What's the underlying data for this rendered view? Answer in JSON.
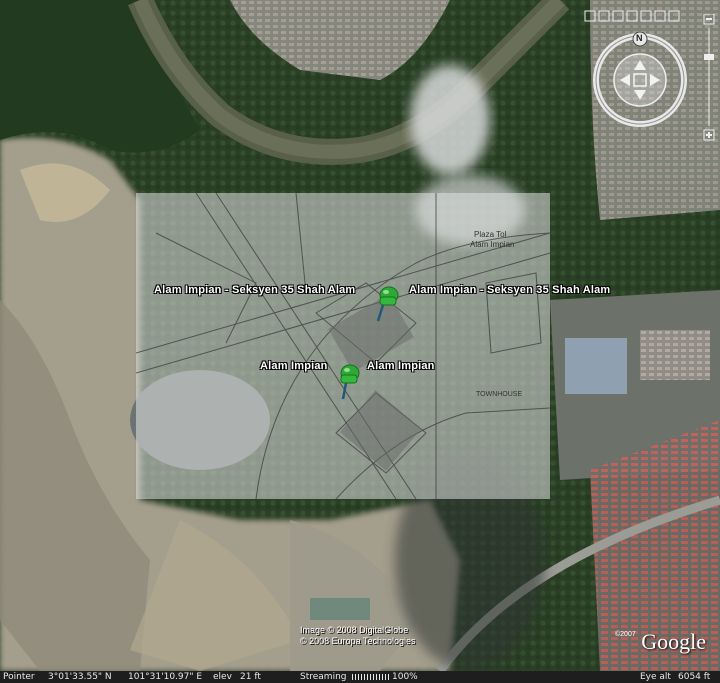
{
  "placemarks": [
    {
      "name": "Alam Impian - Seksyen 35 Shah Alam"
    },
    {
      "name": "Alam Impian"
    }
  ],
  "overlay": {
    "plan_labels": [
      "Plaza Tol",
      "Alam Impian",
      "TOWNHOUSE"
    ]
  },
  "attribution": {
    "line1": "Image © 2008 DigitalGlobe",
    "line2": "© 2008 Europa Technologies",
    "year": "©2007",
    "logo": "Google"
  },
  "navigation": {
    "north_label": "N",
    "icons": [
      "compass-ring-icon",
      "look-joystick-icon",
      "move-joystick-icon",
      "zoom-slider-icon"
    ]
  },
  "status_bar": {
    "pointer_label": "Pointer",
    "lat": "3°01'33.55\" N",
    "lon": "101°31'10.97\" E",
    "elev_label": "elev",
    "elev_value": "21 ft",
    "streaming_label": "Streaming",
    "streaming_percent": "100%",
    "eye_alt_label": "Eye alt",
    "eye_alt_value": "6054 ft"
  },
  "colors": {
    "pin": "#2ea836",
    "river": "#59604a",
    "vegetation": "#2f4a2a",
    "cleared_land": "#a9a394"
  }
}
